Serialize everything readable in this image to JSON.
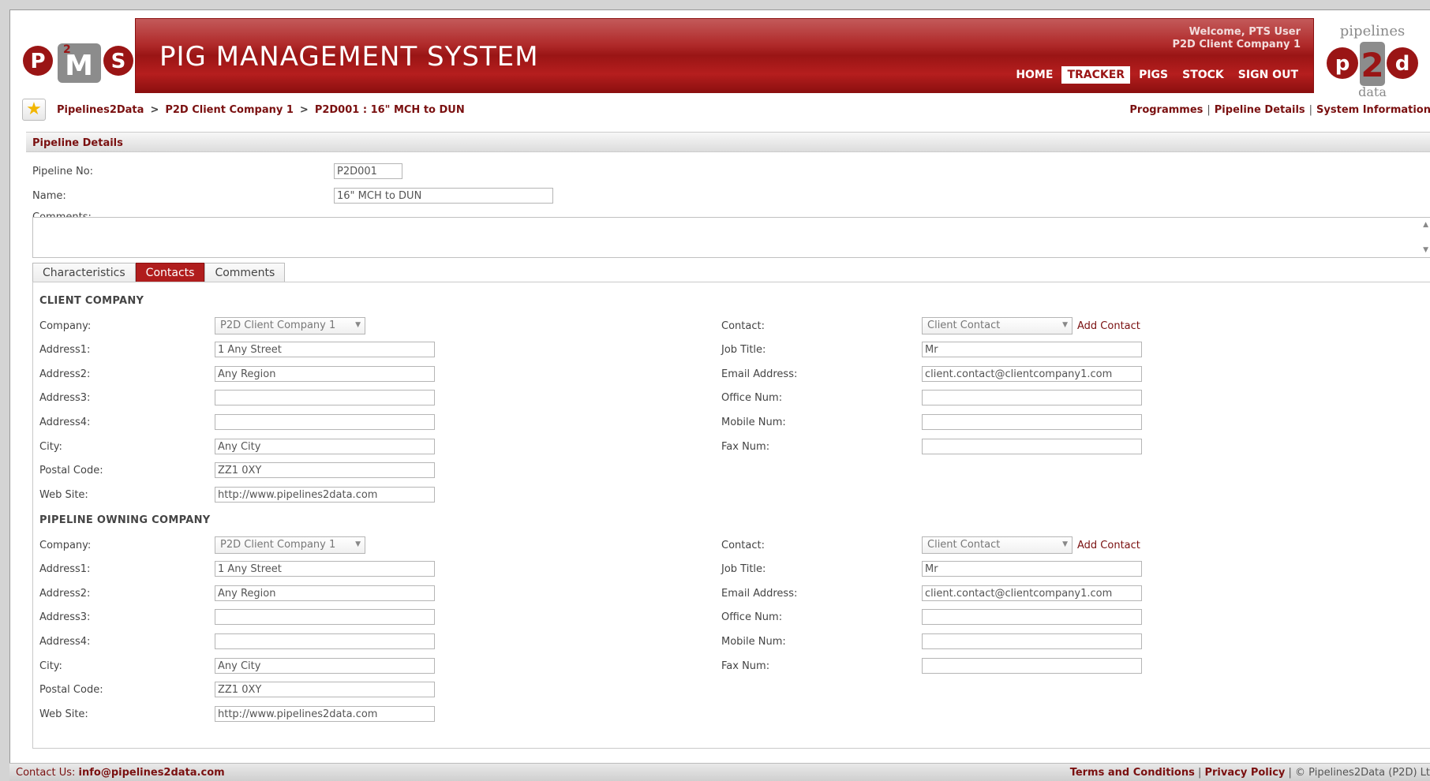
{
  "header": {
    "logo_left": "PMS",
    "title": "PIG MANAGEMENT SYSTEM",
    "welcome_line1": "Welcome, PTS User",
    "welcome_line2": "P2D Client Company 1",
    "nav": [
      {
        "label": "HOME",
        "active": false
      },
      {
        "label": "TRACKER",
        "active": true
      },
      {
        "label": "PIGS",
        "active": false
      },
      {
        "label": "STOCK",
        "active": false
      },
      {
        "label": "SIGN OUT",
        "active": false
      }
    ],
    "logo_right_top": "pipelines",
    "logo_right_mid": "P2d",
    "logo_right_bottom": "data"
  },
  "breadcrumb": {
    "items": [
      "Pipelines2Data",
      "P2D Client Company 1",
      "P2D001 : 16\" MCH to DUN"
    ],
    "separator": ">"
  },
  "top_links": [
    "Programmes",
    "Pipeline Details",
    "System Information"
  ],
  "panel": {
    "title": "Pipeline Details",
    "pipeline_no_label": "Pipeline No:",
    "pipeline_no_value": "P2D001",
    "name_label": "Name:",
    "name_value": "16\" MCH to DUN",
    "comments_label": "Comments:"
  },
  "tabs": [
    {
      "label": "Characteristics",
      "active": false
    },
    {
      "label": "Contacts",
      "active": true
    },
    {
      "label": "Comments",
      "active": false
    }
  ],
  "sections": [
    {
      "title": "CLIENT COMPANY",
      "company_label": "Company:",
      "company_value": "P2D Client Company 1",
      "address1_label": "Address1:",
      "address1_value": "1 Any Street",
      "address2_label": "Address2:",
      "address2_value": "Any Region",
      "address3_label": "Address3:",
      "address3_value": "",
      "address4_label": "Address4:",
      "address4_value": "",
      "city_label": "City:",
      "city_value": "Any City",
      "postal_label": "Postal Code:",
      "postal_value": "ZZ1 0XY",
      "web_label": "Web Site:",
      "web_value": "http://www.pipelines2data.com",
      "contact_label": "Contact:",
      "contact_value": "Client Contact",
      "add_contact": "Add Contact",
      "job_label": "Job Title:",
      "job_value": "Mr",
      "email_label": "Email Address:",
      "email_value": "client.contact@clientcompany1.com",
      "office_label": "Office Num:",
      "office_value": "",
      "mobile_label": "Mobile Num:",
      "mobile_value": "",
      "fax_label": "Fax Num:",
      "fax_value": ""
    },
    {
      "title": "PIPELINE OWNING COMPANY",
      "company_label": "Company:",
      "company_value": "P2D Client Company 1",
      "address1_label": "Address1:",
      "address1_value": "1 Any Street",
      "address2_label": "Address2:",
      "address2_value": "Any Region",
      "address3_label": "Address3:",
      "address3_value": "",
      "address4_label": "Address4:",
      "address4_value": "",
      "city_label": "City:",
      "city_value": "Any City",
      "postal_label": "Postal Code:",
      "postal_value": "ZZ1 0XY",
      "web_label": "Web Site:",
      "web_value": "http://www.pipelines2data.com",
      "contact_label": "Contact:",
      "contact_value": "Client Contact",
      "add_contact": "Add Contact",
      "job_label": "Job Title:",
      "job_value": "Mr",
      "email_label": "Email Address:",
      "email_value": "client.contact@clientcompany1.com",
      "office_label": "Office Num:",
      "office_value": "",
      "mobile_label": "Mobile Num:",
      "mobile_value": "",
      "fax_label": "Fax Num:",
      "fax_value": ""
    }
  ],
  "footer": {
    "contact_prefix": "Contact Us:",
    "contact_email": "info@pipelines2data.com",
    "terms": "Terms and Conditions",
    "privacy": "Privacy Policy",
    "copyright": "© Pipelines2Data (P2D) Lt"
  },
  "colors": {
    "brand_red": "#9a1515",
    "link_red": "#7a1010",
    "tab_active": "#b01d1d"
  }
}
